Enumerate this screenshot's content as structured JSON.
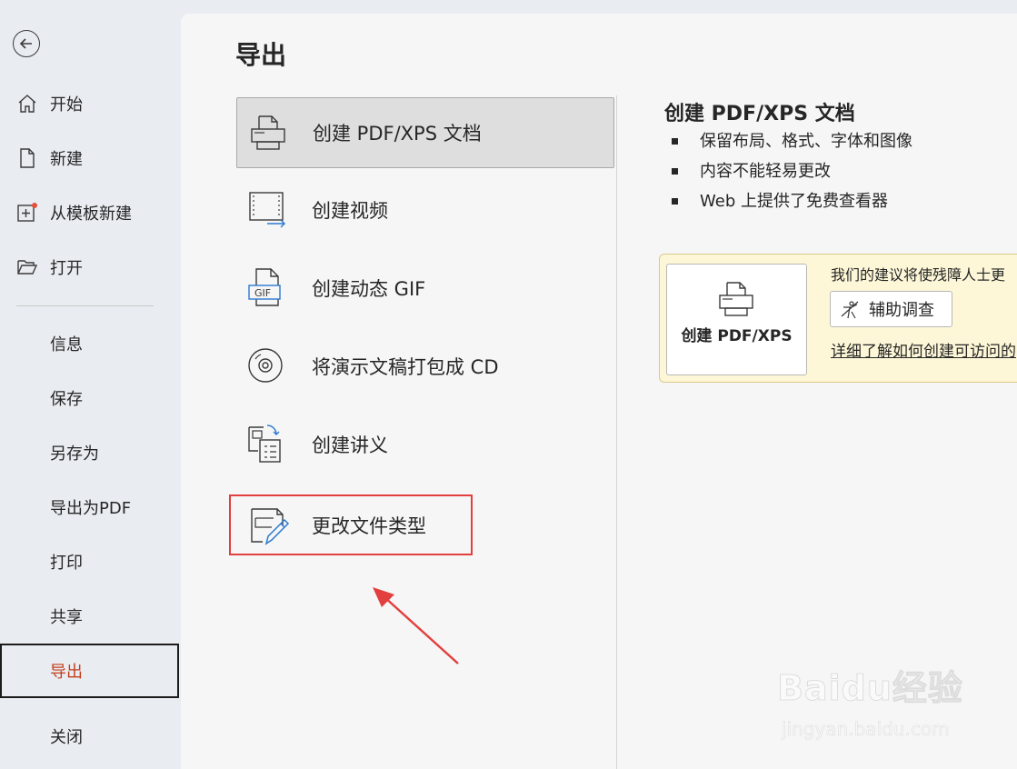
{
  "sidebar": {
    "back_label": "",
    "items": [
      {
        "label": "开始"
      },
      {
        "label": "新建"
      },
      {
        "label": "从模板新建"
      },
      {
        "label": "打开"
      },
      {
        "label": "信息"
      },
      {
        "label": "保存"
      },
      {
        "label": "另存为"
      },
      {
        "label": "导出为PDF"
      },
      {
        "label": "打印"
      },
      {
        "label": "共享"
      },
      {
        "label": "导出"
      },
      {
        "label": "关闭"
      }
    ],
    "active": "导出"
  },
  "main": {
    "title": "导出",
    "options": [
      {
        "label": "创建 PDF/XPS 文档"
      },
      {
        "label": "创建视频"
      },
      {
        "label": "创建动态 GIF"
      },
      {
        "label": "将演示文稿打包成 CD"
      },
      {
        "label": "创建讲义"
      },
      {
        "label": "更改文件类型"
      }
    ],
    "selected": "创建 PDF/XPS 文档",
    "highlighted": "更改文件类型"
  },
  "detail": {
    "title": "创建 PDF/XPS 文档",
    "bullets": [
      "保留布局、格式、字体和图像",
      "内容不能轻易更改",
      "Web 上提供了免费查看器"
    ],
    "callout": {
      "button_label": "创建 PDF/XPS",
      "text": "我们的建议将使残障人士更",
      "assist_button": "辅助调查",
      "link": "详细了解如何创建可访问的"
    }
  },
  "watermark": {
    "logo": "Baidu经验",
    "url": "jingyan.baidu.com"
  },
  "colors": {
    "accent": "#c43e1c",
    "highlight_box": "#e2403f",
    "callout_bg": "#fdf7d7",
    "arrow": "#e2403f"
  }
}
